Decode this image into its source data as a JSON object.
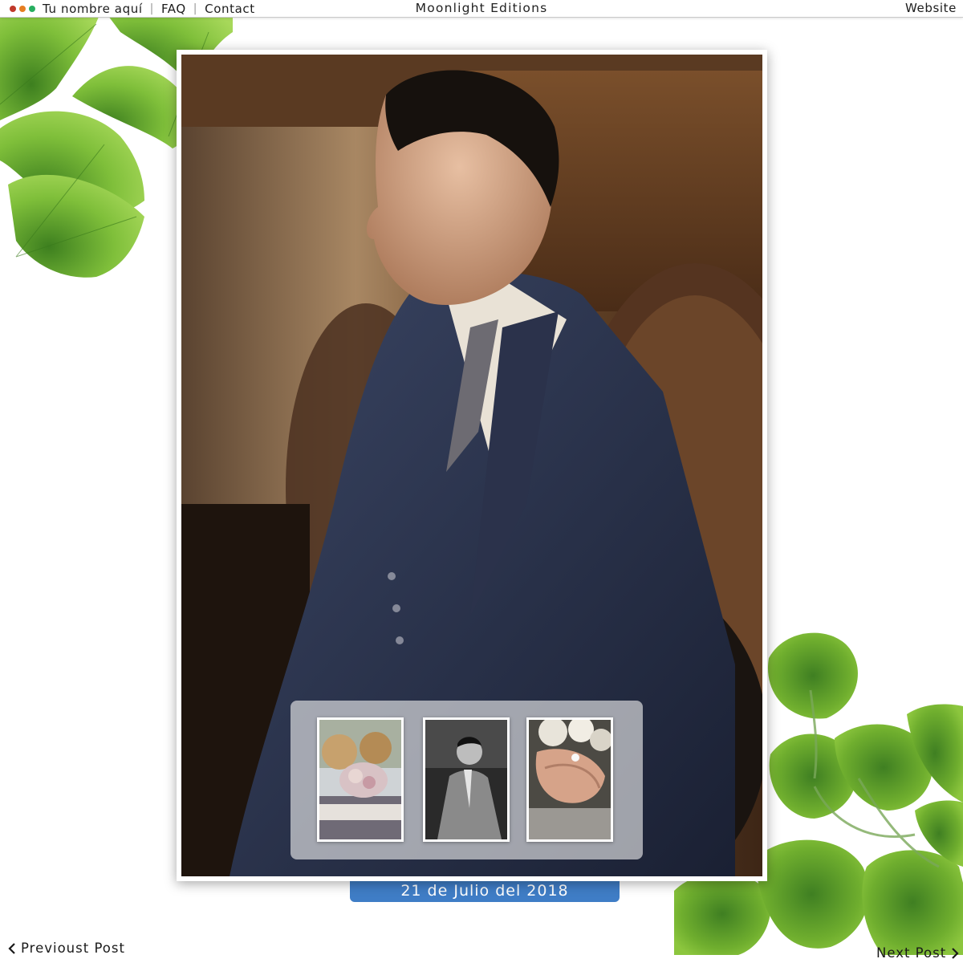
{
  "topbar": {
    "dot_colors": [
      "#c0392b",
      "#e67e22",
      "#27ae60"
    ],
    "nav": [
      {
        "label": "Tu nombre aquí"
      },
      {
        "label": "FAQ"
      },
      {
        "label": "Contact"
      }
    ],
    "title": "Moonlight Editions",
    "website_label": "Website"
  },
  "post": {
    "main_image": "portrait-man-in-pinstripe-suit",
    "thumbnails": [
      {
        "subject": "wedding-table-flowers"
      },
      {
        "subject": "man-in-suit-black-and-white"
      },
      {
        "subject": "hands-with-rings-and-bouquet"
      }
    ],
    "date": "21 de Julio del 2018"
  },
  "pagination": {
    "prev_label": "Previoust Post",
    "next_label": "Next Post"
  },
  "colors": {
    "date_bg": "#3f7dc6",
    "leaf_green": "#6fae2e"
  }
}
